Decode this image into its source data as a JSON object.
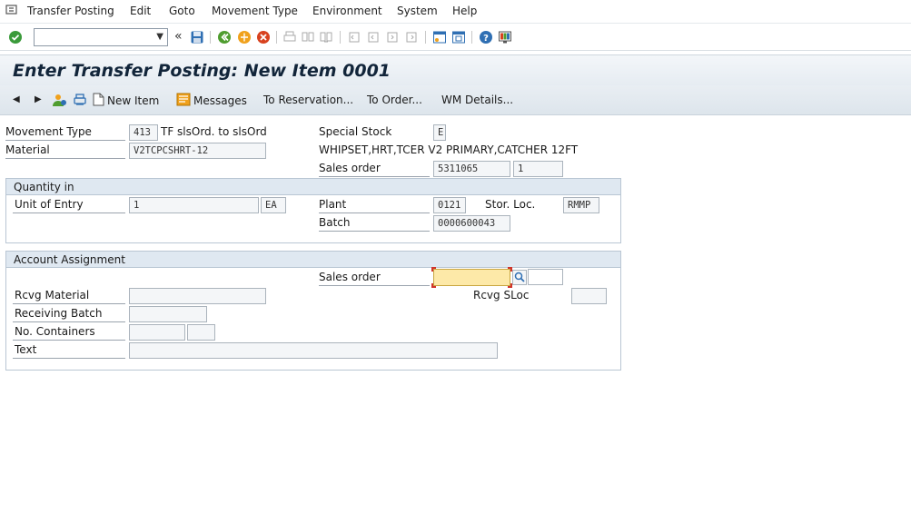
{
  "menubar": {
    "items": [
      "Transfer Posting",
      "Edit",
      "Goto",
      "Movement Type",
      "Environment",
      "System",
      "Help"
    ]
  },
  "toolbar": {
    "command_field_value": "",
    "icons": [
      "enter-icon",
      "save-icon",
      "back-icon",
      "exit-icon",
      "cancel-icon",
      "print-icon",
      "find-icon",
      "find-next-icon",
      "first-page-icon",
      "previous-page-icon",
      "next-page-icon",
      "last-page-icon",
      "create-session-icon",
      "shortcut-icon",
      "help-icon",
      "customize-layout-icon"
    ]
  },
  "title": "Enter Transfer Posting: New Item 0001",
  "app_toolbar": {
    "new_item": "New Item",
    "messages": "Messages",
    "to_reservation": "To Reservation...",
    "to_order": "To Order...",
    "wm_details": "WM Details..."
  },
  "header": {
    "movement_type_label": "Movement Type",
    "movement_type_value": "413",
    "movement_type_text": "TF slsOrd. to slsOrd",
    "material_label": "Material",
    "material_value": "V2TCPCSHRT-12",
    "special_stock_label": "Special Stock",
    "special_stock_value": "E",
    "material_description": "WHIPSET,HRT,TCER V2 PRIMARY,CATCHER 12FT",
    "sales_order_label": "Sales order",
    "sales_order_value": "5311065",
    "sales_order_item": "1"
  },
  "quantity": {
    "group_title": "Quantity in",
    "unit_of_entry_label": "Unit of Entry",
    "unit_of_entry_value": "1",
    "unit": "EA",
    "plant_label": "Plant",
    "plant_value": "0121",
    "stor_loc_label": "Stor. Loc.",
    "stor_loc_value": "RMMP",
    "batch_label": "Batch",
    "batch_value": "0000600043"
  },
  "account": {
    "group_title": "Account Assignment",
    "sales_order_label": "Sales order",
    "sales_order_value": "",
    "sales_order_item": "",
    "rcvg_material_label": "Rcvg Material",
    "rcvg_material_value": "",
    "rcvg_sloc_label": "Rcvg SLoc",
    "rcvg_sloc_value": "",
    "receiving_batch_label": "Receiving Batch",
    "receiving_batch_value": "",
    "containers_label": "No. Containers",
    "containers_value1": "",
    "containers_value2": "",
    "text_label": "Text",
    "text_value": ""
  }
}
